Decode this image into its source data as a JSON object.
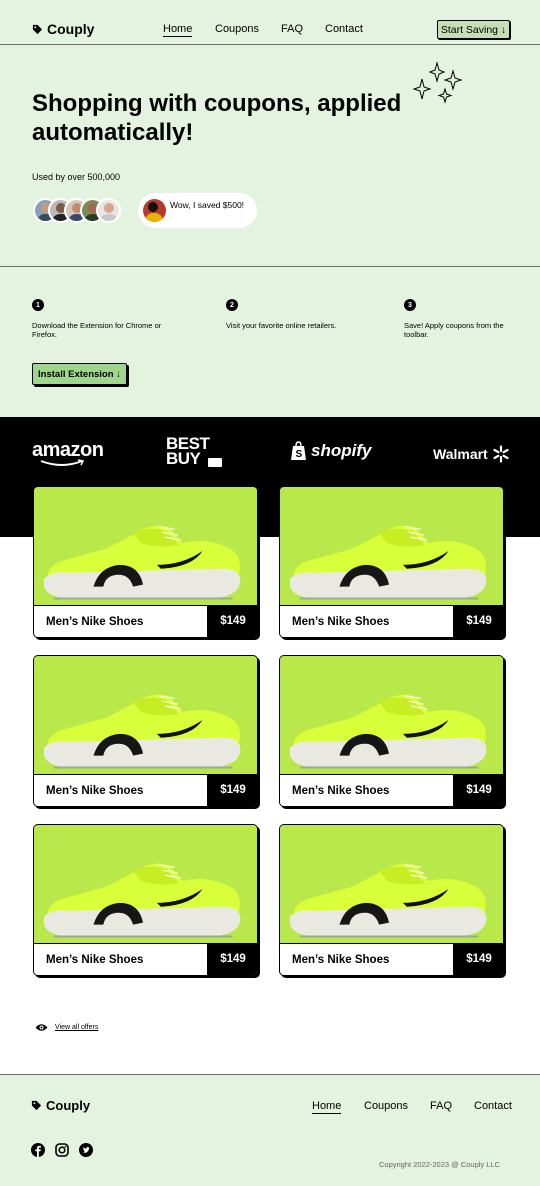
{
  "brand": {
    "name": "Couply",
    "logo_icon": "tag-icon"
  },
  "nav": {
    "items": [
      {
        "label": "Home",
        "active": true
      },
      {
        "label": "Coupons",
        "active": false
      },
      {
        "label": "FAQ",
        "active": false
      },
      {
        "label": "Contact",
        "active": false
      }
    ],
    "cta_label": "Start Saving ↓"
  },
  "hero": {
    "title": "Shopping with coupons, applied automatically!",
    "used_by": "Used by over 500,000",
    "testimonial": "Wow, I saved $500!"
  },
  "steps": [
    {
      "number": "1",
      "text": "Download the Extension for Chrome or Firefox."
    },
    {
      "number": "2",
      "text": "Visit your favorite online retailers."
    },
    {
      "number": "3",
      "text": "Save! Apply coupons from the toolbar."
    }
  ],
  "install_label": "Install Extension ↓",
  "brands": [
    "amazon",
    "BEST BUY",
    "shopify",
    "Walmart"
  ],
  "products": [
    {
      "name": "Men’s Nike Shoes",
      "price": "$149"
    },
    {
      "name": "Men’s Nike Shoes",
      "price": "$149"
    },
    {
      "name": "Men’s Nike Shoes",
      "price": "$149"
    },
    {
      "name": "Men’s Nike Shoes",
      "price": "$149"
    },
    {
      "name": "Men’s Nike Shoes",
      "price": "$149"
    },
    {
      "name": "Men’s Nike Shoes",
      "price": "$149"
    }
  ],
  "view_all_label": "View all offers",
  "footer": {
    "brand": "Couply",
    "nav": [
      "Home",
      "Coupons",
      "FAQ",
      "Contact"
    ],
    "social_icons": [
      "facebook-icon",
      "instagram-icon",
      "twitter-icon"
    ],
    "copyright": "Copyright 2022-2023 @ Couply LLC"
  },
  "colors": {
    "background_tint": "#e4f2e0",
    "accent_green": "#9fd58c",
    "product_bg": "#b8e84a",
    "dark": "#000000"
  }
}
